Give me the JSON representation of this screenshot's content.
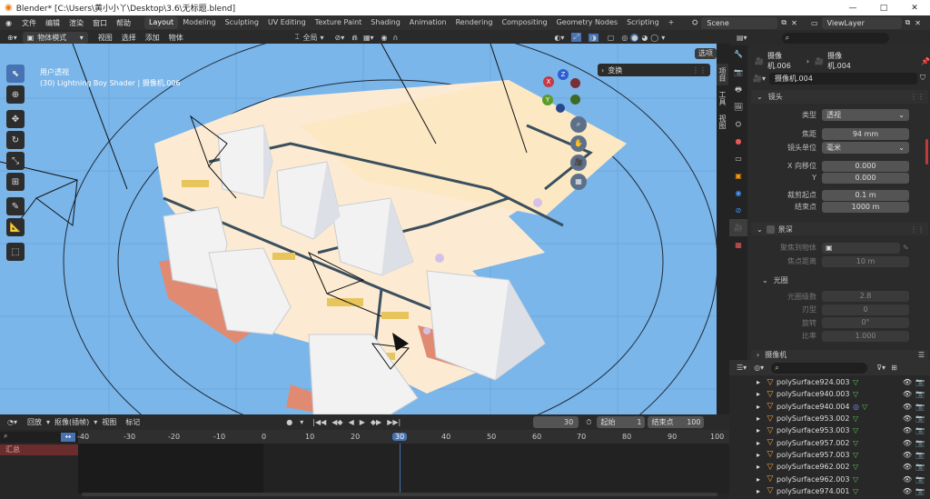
{
  "window": {
    "title": "Blender* [C:\\Users\\黄小小丫\\Desktop\\3.6\\无标题.blend]",
    "controls": [
      "—",
      "□",
      "✕"
    ]
  },
  "menu": [
    "文件",
    "编辑",
    "渲染",
    "窗口",
    "帮助"
  ],
  "workspaces": [
    "Layout",
    "Modeling",
    "Sculpting",
    "UV Editing",
    "Texture Paint",
    "Shading",
    "Animation",
    "Rendering",
    "Compositing",
    "Geometry Nodes",
    "Scripting",
    "+"
  ],
  "scene": {
    "name": "Scene",
    "viewlayer": "ViewLayer"
  },
  "viewport_header": {
    "mode": "物体模式",
    "menus": [
      "视图",
      "选择",
      "添加",
      "物体"
    ],
    "orientation": "全局",
    "options_btn": "选项"
  },
  "overlay": {
    "line1": "用户透视",
    "line2": "(30) Lightning Boy Shader | 摄像机.006",
    "transform_panel": "变换"
  },
  "gizmo": {
    "x": "X",
    "y": "Y",
    "z": "Z"
  },
  "side_tabs": [
    "项目",
    "工具",
    "视图"
  ],
  "properties": {
    "breadcrumb_a": "摄像机.006",
    "breadcrumb_b": "摄像机.004",
    "data_name": "摄像机.004",
    "section_lens": "镜头",
    "rows": [
      {
        "label": "类型",
        "value": "透视",
        "dropdown": true
      },
      {
        "label": "焦距",
        "value": "94 mm"
      },
      {
        "label": "镜头单位",
        "value": "毫米",
        "dropdown": true
      },
      {
        "label": "X 向移位",
        "value": "0.000"
      },
      {
        "label": "Y",
        "value": "0.000"
      },
      {
        "label": "裁剪起点",
        "value": "0.1 m"
      },
      {
        "label": "结束点",
        "value": "1000 m"
      }
    ],
    "section_dof": "景深",
    "dof_rows": [
      {
        "label": "聚焦到物体",
        "value": ""
      },
      {
        "label": "焦点距离",
        "value": "10 m"
      }
    ],
    "section_aperture": "光圈",
    "aperture_rows": [
      {
        "label": "光圈级数",
        "value": "2.8"
      },
      {
        "label": "刃型",
        "value": "0"
      },
      {
        "label": "旋转",
        "value": "0°"
      },
      {
        "label": "比率",
        "value": "1.000"
      }
    ],
    "section_camera": "摄像机"
  },
  "outliner": {
    "items": [
      "polySurface924.003",
      "polySurface940.003",
      "polySurface940.004",
      "polySurface953.002",
      "polySurface953.003",
      "polySurface957.002",
      "polySurface957.003",
      "polySurface962.002",
      "polySurface962.003",
      "polySurface974.001"
    ]
  },
  "timeline": {
    "menus": [
      "回放",
      "抠像(插帧)",
      "视图",
      "标记"
    ],
    "current_frame": "30",
    "start_label": "起始",
    "start": "1",
    "end_label": "结束点",
    "end": "100",
    "ticks": [
      "-40",
      "-30",
      "-20",
      "-10",
      "0",
      "10",
      "20",
      "30",
      "40",
      "50",
      "60",
      "70",
      "80",
      "90",
      "100"
    ],
    "summary": "汇总"
  },
  "colors": {
    "accent": "#4772b3",
    "sky": "#7ab6ea",
    "road": "#fcebd2",
    "frame_marker": "#4772b3"
  }
}
